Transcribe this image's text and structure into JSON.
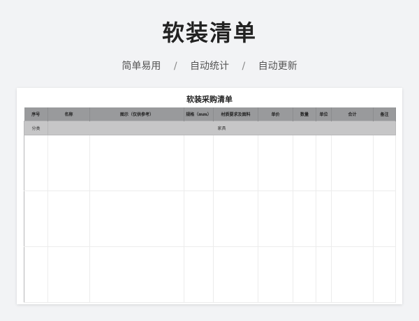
{
  "page": {
    "title": "软装清单",
    "tags": [
      "简单易用",
      "自动统计",
      "自动更新"
    ],
    "separator": "/"
  },
  "sheet": {
    "title": "软装采购清单",
    "headers": [
      "序号",
      "名称",
      "图示（仅供参考）",
      "规格（mm）",
      "材质要求及面料",
      "单价",
      "数量",
      "单位",
      "合计",
      "备注"
    ],
    "category_label": "分类",
    "category_value": "家具"
  }
}
